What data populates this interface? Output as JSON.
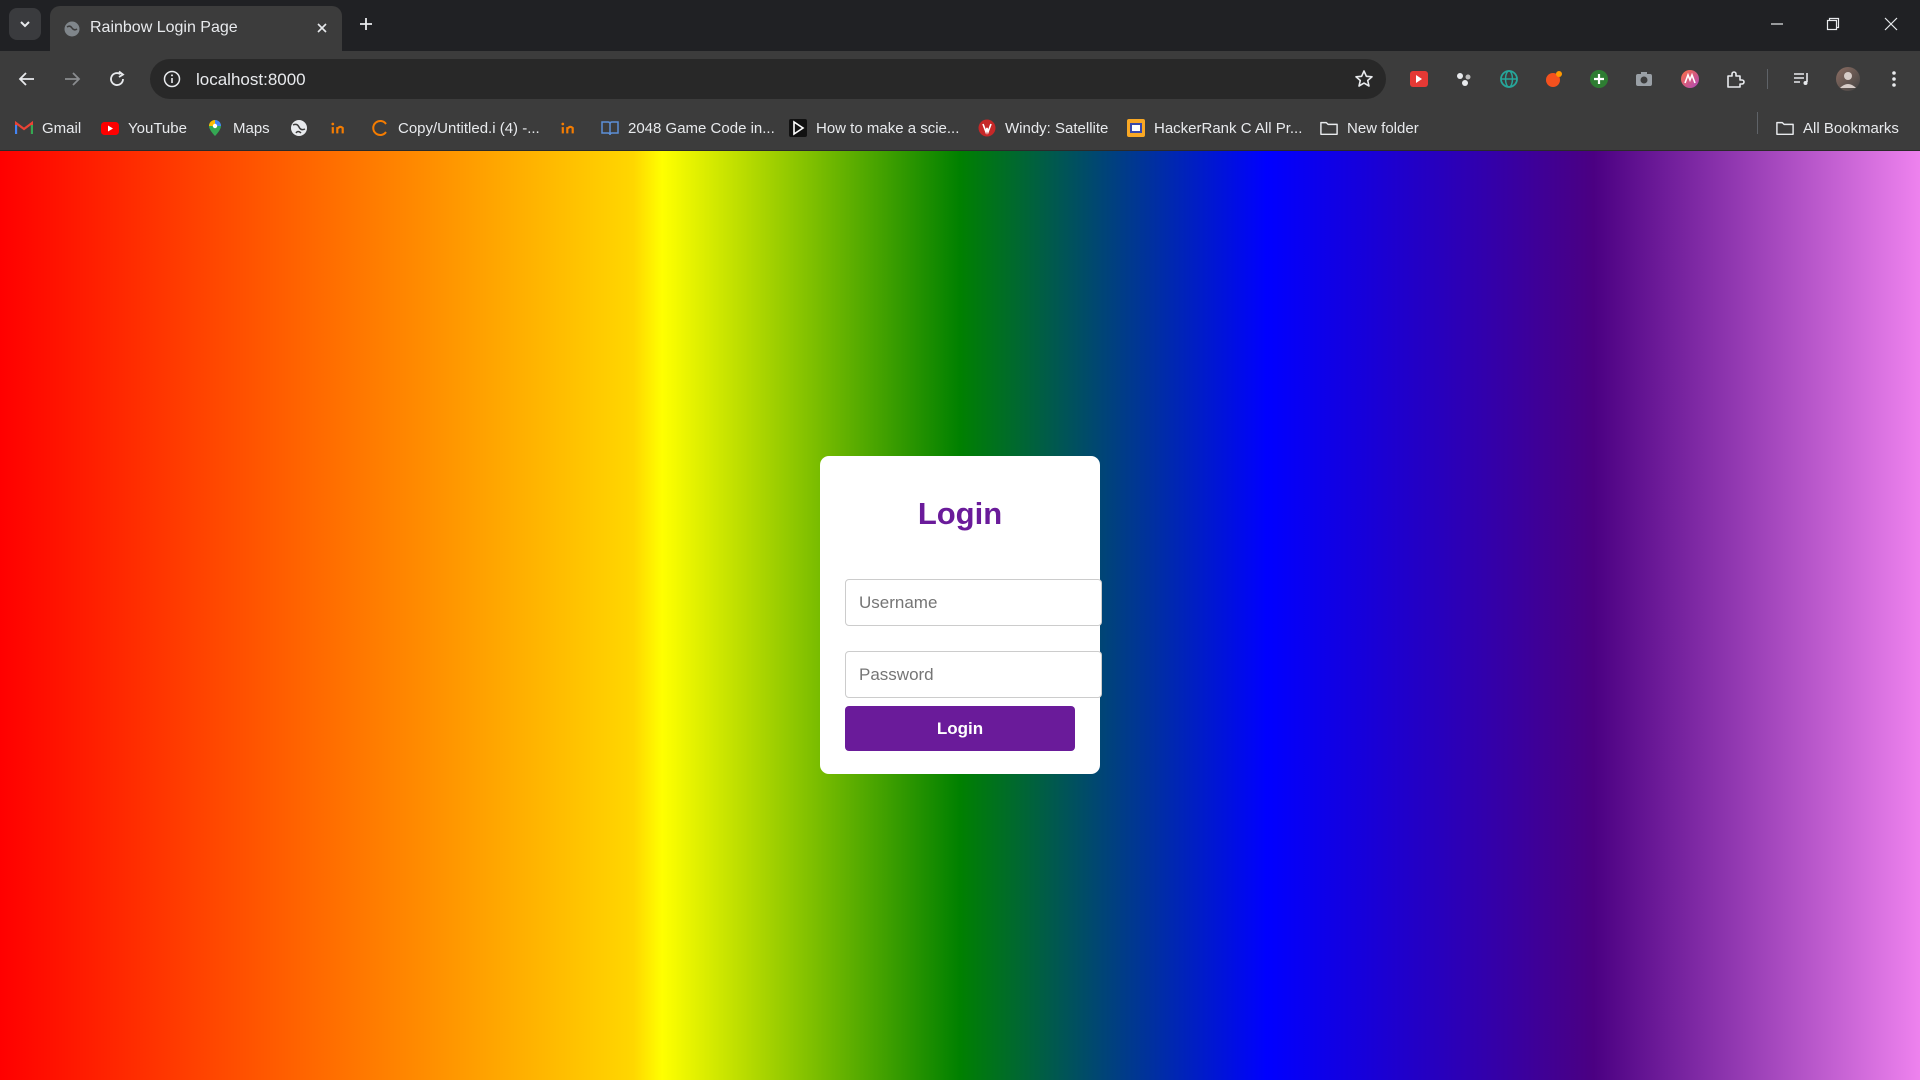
{
  "browser": {
    "tab": {
      "title": "Rainbow Login Page"
    },
    "address_bar": {
      "url": "localhost:8000"
    },
    "extensions": [
      "red-play-extension-icon",
      "dots-extension-icon",
      "teal-globe-extension-icon",
      "orange-extension-icon",
      "green-plus-extension-icon",
      "camera-extension-icon",
      "ai-extension-icon",
      "puzzle-icon",
      "media-control-icon",
      "profile-avatar"
    ],
    "bookmarks": [
      {
        "label": "Gmail",
        "icon": "gmail-icon"
      },
      {
        "label": "YouTube",
        "icon": "youtube-icon"
      },
      {
        "label": "Maps",
        "icon": "maps-icon"
      },
      {
        "label": "",
        "icon": "globe-icon"
      },
      {
        "label": "",
        "icon": "in-icon"
      },
      {
        "label": "Copy/Untitled.i (4) -...",
        "icon": "loading-arc-icon"
      },
      {
        "label": "",
        "icon": "in-icon"
      },
      {
        "label": "2048 Game Code in...",
        "icon": "book-icon"
      },
      {
        "label": "How to make a scie...",
        "icon": "video-icon"
      },
      {
        "label": "Windy: Satellite",
        "icon": "windy-icon"
      },
      {
        "label": "HackerRank C All Pr...",
        "icon": "hackerrank-icon"
      },
      {
        "label": "New folder",
        "icon": "folder-icon"
      }
    ],
    "all_bookmarks_label": "All Bookmarks"
  },
  "page": {
    "title": "Login",
    "username_placeholder": "Username",
    "password_placeholder": "Password",
    "button_label": "Login",
    "accent_color": "#6a1b9a",
    "background_gradient_colors": [
      "#ff0000",
      "#ff8c00",
      "#ffd700",
      "#ffff00",
      "#008000",
      "#0000ff",
      "#4b0082",
      "#ee82ee"
    ]
  }
}
